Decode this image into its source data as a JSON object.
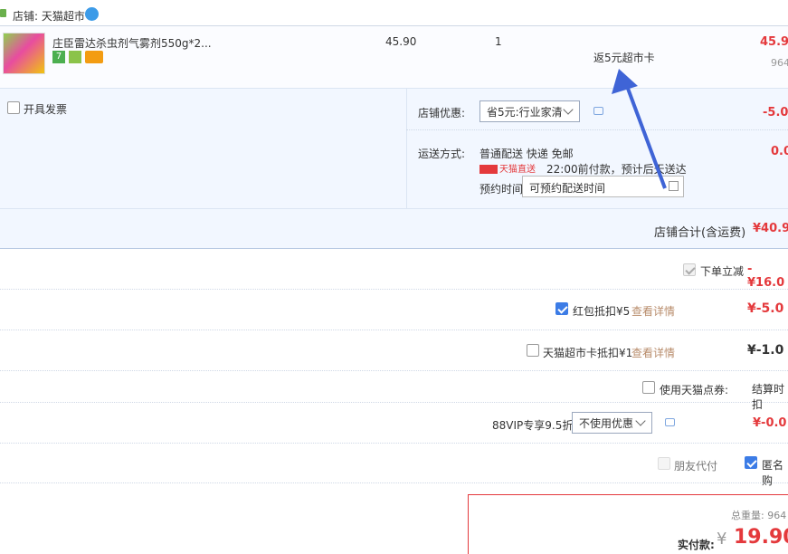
{
  "shop": {
    "label": "店铺: 天猫超市"
  },
  "item": {
    "name": "庄臣雷达杀虫剂气雾剂550g*2...",
    "price": "45.90",
    "qty": "1",
    "rebate": "返5元超市卡",
    "total": "45.9",
    "weight": "964"
  },
  "invoice": {
    "label": "开具发票"
  },
  "coupon": {
    "label": "店铺优惠:",
    "selected": "省5元:行业家清",
    "amount": "-5.0"
  },
  "shipping": {
    "label": "运送方式:",
    "method": "普通配送 快递 免邮",
    "badge": "天猫直送",
    "desc": "22:00前付款，预计后天送达",
    "amount": "0.0",
    "schedule_label": "预约时间",
    "schedule_placeholder": "可预约配送时间"
  },
  "shop_total": {
    "label": "店铺合计(含运费)",
    "amount": "¥40.9"
  },
  "discounts": {
    "order_discount": {
      "label": "下单立减",
      "amount": "-¥16.0"
    },
    "redpacket": {
      "label": "红包抵扣¥5",
      "link": "查看详情",
      "amount": "¥-5.0"
    },
    "tmcard": {
      "label": "天猫超市卡抵扣¥1",
      "link": "查看详情",
      "amount": "¥-1.0"
    },
    "points": {
      "label": "使用天猫点券:",
      "note": "结算时扣"
    },
    "vip": {
      "label": "88VIP专享9.5折",
      "selected": "不使用优惠",
      "amount": "¥-0.0"
    }
  },
  "friend_pay": {
    "label": "朋友代付"
  },
  "anonymous": {
    "label": "匿名购"
  },
  "summary": {
    "weight_label": "总重量: 964",
    "pay_label": "实付款:",
    "pay_currency": "¥",
    "pay_amount": "19.90"
  },
  "colors": {
    "accent_red": "#e4393c",
    "panel_bg": "#f2f7ff",
    "arrow_blue": "#3f64d6"
  }
}
